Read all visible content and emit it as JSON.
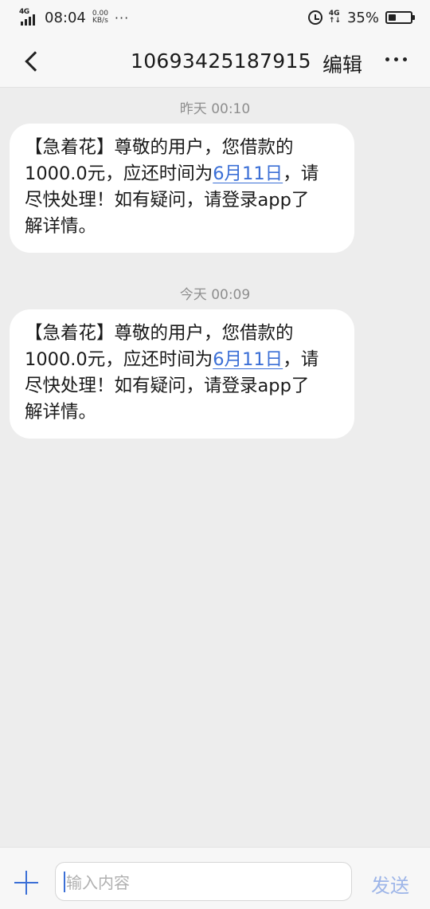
{
  "status_bar": {
    "network": "4G",
    "time": "08:04",
    "speed_value": "0.00",
    "speed_unit": "KB/s",
    "battery": "35%",
    "battery_level": 0.35
  },
  "header": {
    "title": "10693425187915",
    "edit_label": "编辑"
  },
  "messages": [
    {
      "time": "昨天 00:10",
      "lines": [
        "【急着花】尊敬的用户，您借款的",
        "1000.0元，应还时间为",
        "，请",
        "尽快处理！如有疑问，请登录app了",
        "解详情。"
      ],
      "date_link": "6月11日"
    },
    {
      "time": "今天 00:09",
      "lines": [
        "【急着花】尊敬的用户，您借款的",
        "1000.0元，应还时间为",
        "，请",
        "尽快处理！如有疑问，请登录app了",
        "解详情。"
      ],
      "date_link": "6月11日"
    }
  ],
  "input_bar": {
    "placeholder": "输入内容",
    "send_label": "发送"
  },
  "colors": {
    "accent": "#3b6fd6",
    "background": "#ededed",
    "bubble": "#ffffff"
  }
}
